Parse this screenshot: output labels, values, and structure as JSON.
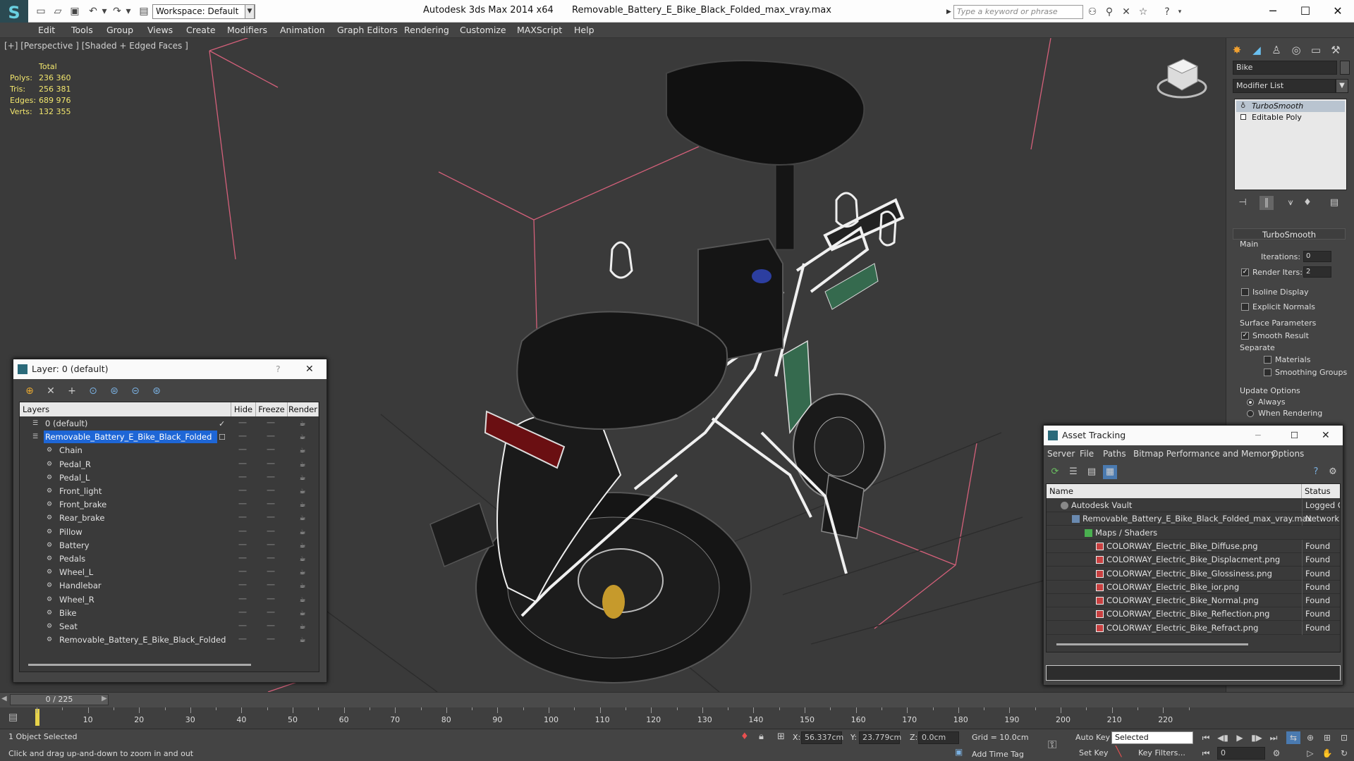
{
  "window": {
    "app_title": "Autodesk 3ds Max  2014 x64",
    "file_title": "Removable_Battery_E_Bike_Black_Folded_max_vray.max",
    "workspace": "Workspace: Default",
    "search_placeholder": "Type a keyword or phrase"
  },
  "menubar": [
    "Edit",
    "Tools",
    "Group",
    "Views",
    "Create",
    "Modifiers",
    "Animation",
    "Graph Editors",
    "Rendering",
    "Customize",
    "MAXScript",
    "Help"
  ],
  "viewport": {
    "label": "[+] [Perspective ] [Shaded + Edged Faces ]",
    "stats": {
      "header": "Total",
      "rows": [
        {
          "label": "Polys:",
          "value": "236 360"
        },
        {
          "label": "Tris:",
          "value": "256 381"
        },
        {
          "label": "Edges:",
          "value": "689 976"
        },
        {
          "label": "Verts:",
          "value": "132 355"
        }
      ]
    }
  },
  "command_panel": {
    "object_name": "Bike",
    "modifier_list": "Modifier List",
    "stack": [
      "TurboSmooth",
      "Editable Poly"
    ],
    "rollout_title": "TurboSmooth",
    "main_label": "Main",
    "iterations_label": "Iterations:",
    "iterations_value": "0",
    "render_iters_label": "Render Iters:",
    "render_iters_value": "2",
    "isoline_label": "Isoline Display",
    "explicit_normals_label": "Explicit Normals",
    "surface_params_label": "Surface Parameters",
    "smooth_result_label": "Smooth Result",
    "separate_label": "Separate",
    "materials_label": "Materials",
    "smoothing_groups_label": "Smoothing Groups",
    "update_options_label": "Update Options",
    "always_label": "Always",
    "when_rendering_label": "When Rendering"
  },
  "layer_dialog": {
    "title": "Layer: 0 (default)",
    "help": "?",
    "columns": [
      "Layers",
      "Hide",
      "Freeze",
      "Render"
    ],
    "layers": [
      {
        "name": "0 (default)"
      },
      {
        "name": "Removable_Battery_E_Bike_Black_Folded"
      },
      {
        "name": "Chain"
      },
      {
        "name": "Pedal_R"
      },
      {
        "name": "Pedal_L"
      },
      {
        "name": "Front_light"
      },
      {
        "name": "Front_brake"
      },
      {
        "name": "Rear_brake"
      },
      {
        "name": "Pillow"
      },
      {
        "name": "Battery"
      },
      {
        "name": "Pedals"
      },
      {
        "name": "Wheel_L"
      },
      {
        "name": "Handlebar"
      },
      {
        "name": "Wheel_R"
      },
      {
        "name": "Bike"
      },
      {
        "name": "Seat"
      },
      {
        "name": "Removable_Battery_E_Bike_Black_Folded"
      }
    ]
  },
  "asset_tracking": {
    "title": "Asset Tracking",
    "menu": [
      "Server",
      "File",
      "Paths",
      "Bitmap Performance and Memory",
      "Options"
    ],
    "columns": [
      "Name",
      "Status"
    ],
    "rows": [
      {
        "name": "Autodesk Vault",
        "status": "Logged Out"
      },
      {
        "name": "Removable_Battery_E_Bike_Black_Folded_max_vray.max",
        "status": "Network Path"
      },
      {
        "name": "Maps / Shaders",
        "status": ""
      },
      {
        "name": "COLORWAY_Electric_Bike_Diffuse.png",
        "status": "Found"
      },
      {
        "name": "COLORWAY_Electric_Bike_Displacment.png",
        "status": "Found"
      },
      {
        "name": "COLORWAY_Electric_Bike_Glossiness.png",
        "status": "Found"
      },
      {
        "name": "COLORWAY_Electric_Bike_ior.png",
        "status": "Found"
      },
      {
        "name": "COLORWAY_Electric_Bike_Normal.png",
        "status": "Found"
      },
      {
        "name": "COLORWAY_Electric_Bike_Reflection.png",
        "status": "Found"
      },
      {
        "name": "COLORWAY_Electric_Bike_Refract.png",
        "status": "Found"
      }
    ]
  },
  "timeline": {
    "frame_display": "0 / 225",
    "ticks": [
      "10",
      "20",
      "30",
      "40",
      "50",
      "60",
      "70",
      "80",
      "90",
      "100",
      "110",
      "120",
      "130",
      "140",
      "150",
      "160",
      "170",
      "180",
      "190",
      "200",
      "210",
      "220"
    ]
  },
  "status": {
    "selection": "1 Object Selected",
    "prompt": "Click and drag up-and-down to zoom in and out",
    "x_label": "X:",
    "x_value": "56.337cm",
    "y_label": "Y:",
    "y_value": "23.779cm",
    "z_label": "Z:",
    "z_value": "0.0cm",
    "grid": "Grid = 10.0cm",
    "add_time_tag": "Add Time Tag",
    "auto_key": "Auto Key",
    "set_key": "Set Key",
    "selected": "Selected",
    "key_filters": "Key Filters...",
    "frame": "0"
  },
  "colors": {
    "stats": "#f2e66d",
    "selection_blue": "#1e66d6",
    "bbox": "#d4607a"
  }
}
